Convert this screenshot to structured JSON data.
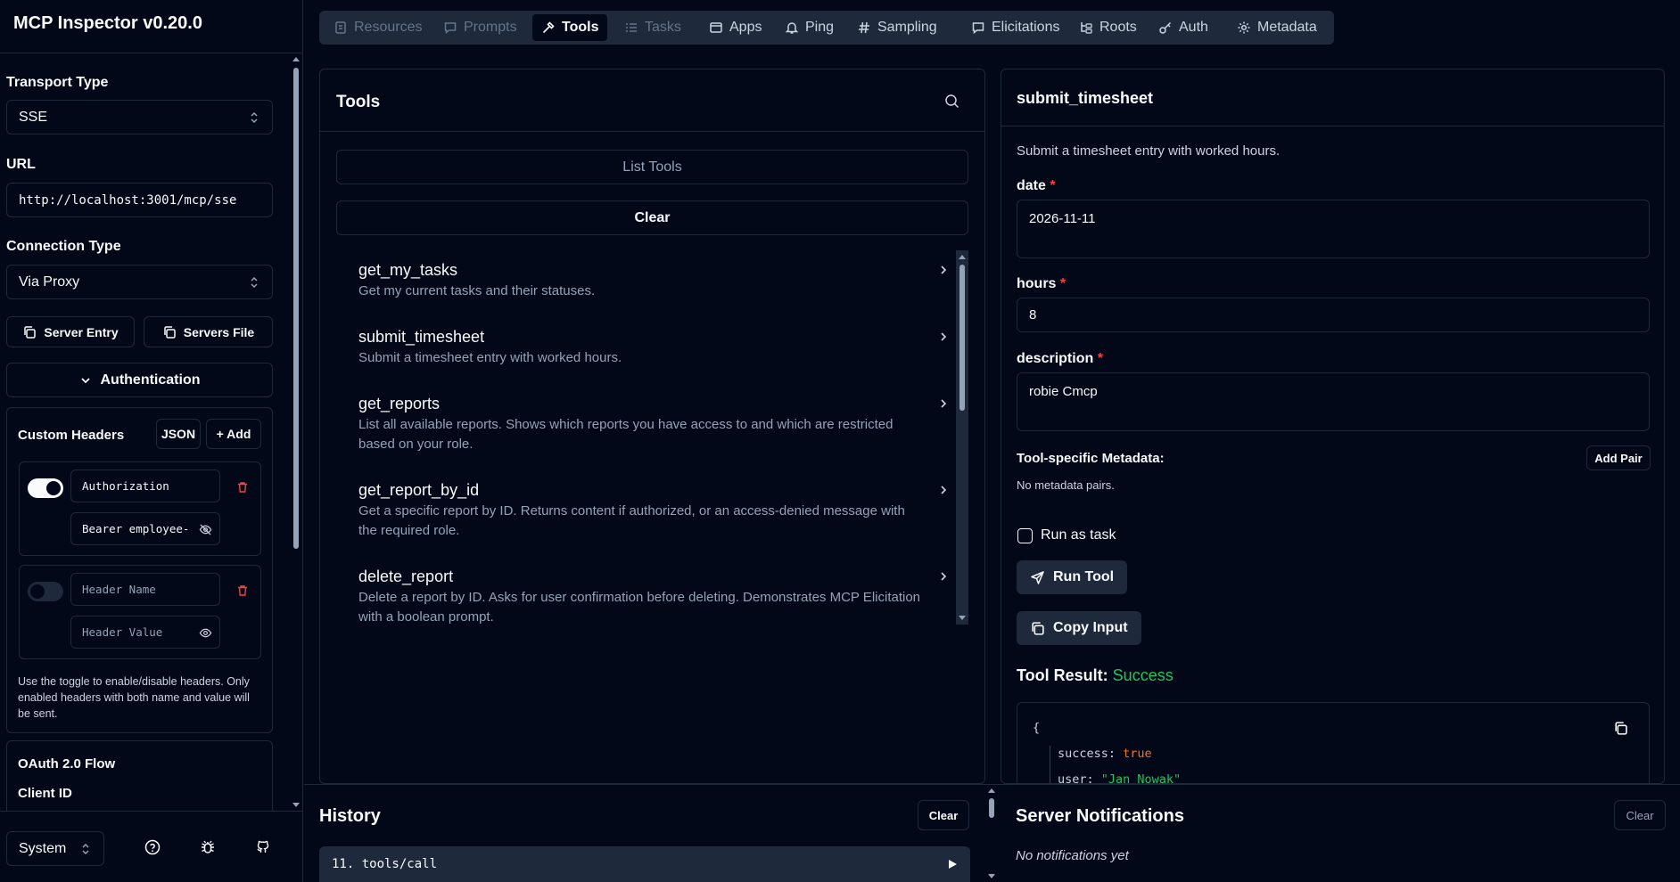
{
  "app": {
    "title": "MCP Inspector v0.20.0"
  },
  "sidebar": {
    "transport_label": "Transport Type",
    "transport_value": "SSE",
    "url_label": "URL",
    "url_value": "http://localhost:3001/mcp/sse",
    "connection_label": "Connection Type",
    "connection_value": "Via Proxy",
    "server_entry_label": "Server Entry",
    "servers_file_label": "Servers File",
    "authentication_label": "Authentication",
    "custom_headers": {
      "title": "Custom Headers",
      "json_label": "JSON",
      "add_label": "+ Add",
      "headers": [
        {
          "enabled": true,
          "name": "Authorization",
          "value": "Bearer employee-"
        },
        {
          "enabled": false,
          "name_placeholder": "Header Name",
          "value_placeholder": "Header Value"
        }
      ],
      "help": "Use the toggle to enable/disable headers. Only enabled headers with both name and value will be sent."
    },
    "oauth": {
      "title": "OAuth 2.0 Flow",
      "client_id_label": "Client ID"
    },
    "theme_value": "System"
  },
  "tabs": [
    {
      "label": "Resources",
      "icon": "file-icon",
      "state": "disabled"
    },
    {
      "label": "Prompts",
      "icon": "message-icon",
      "state": "disabled"
    },
    {
      "label": "Tools",
      "icon": "hammer-icon",
      "state": "active"
    },
    {
      "label": "Tasks",
      "icon": "list-icon",
      "state": "disabled"
    },
    {
      "label": "Apps",
      "icon": "app-window-icon",
      "state": "normal"
    },
    {
      "label": "Ping",
      "icon": "bell-icon",
      "state": "normal"
    },
    {
      "label": "Sampling",
      "icon": "hash-icon",
      "state": "normal"
    },
    {
      "label": "Elicitations",
      "icon": "message-icon",
      "state": "normal"
    },
    {
      "label": "Roots",
      "icon": "folder-tree-icon",
      "state": "normal"
    },
    {
      "label": "Auth",
      "icon": "key-icon",
      "state": "normal"
    },
    {
      "label": "Metadata",
      "icon": "gear-icon",
      "state": "normal"
    }
  ],
  "tools": {
    "title": "Tools",
    "list_label": "List Tools",
    "clear_label": "Clear",
    "items": [
      {
        "name": "get_my_tasks",
        "desc": "Get my current tasks and their statuses."
      },
      {
        "name": "submit_timesheet",
        "desc": "Submit a timesheet entry with worked hours."
      },
      {
        "name": "get_reports",
        "desc": "List all available reports. Shows which reports you have access to and which are restricted based on your role."
      },
      {
        "name": "get_report_by_id",
        "desc": "Get a specific report by ID. Returns content if authorized, or an access-denied message with the required role."
      },
      {
        "name": "delete_report",
        "desc": "Delete a report by ID. Asks for user confirmation before deleting. Demonstrates MCP Elicitation with a boolean prompt."
      }
    ]
  },
  "detail": {
    "title": "submit_timesheet",
    "desc": "Submit a timesheet entry with worked hours.",
    "fields": [
      {
        "label": "date",
        "value": "2026-11-11"
      },
      {
        "label": "hours",
        "value": "8"
      },
      {
        "label": "description",
        "value": "robie Cmcp"
      }
    ],
    "required_mark": "*",
    "meta_label": "Tool-specific Metadata:",
    "add_pair_label": "Add Pair",
    "meta_empty": "No metadata pairs.",
    "run_as_task_label": "Run as task",
    "run_tool_label": "Run Tool",
    "copy_input_label": "Copy Input",
    "result_label": "Tool Result:",
    "result_status": "Success",
    "result_json": {
      "open": "{",
      "success_key": "success:",
      "success_val": "true",
      "user_key": "user:",
      "user_val": "\"Jan Nowak\""
    }
  },
  "history": {
    "title": "History",
    "clear_label": "Clear",
    "item": "11. tools/call"
  },
  "notifications": {
    "title": "Server Notifications",
    "clear_label": "Clear",
    "empty": "No notifications yet"
  }
}
